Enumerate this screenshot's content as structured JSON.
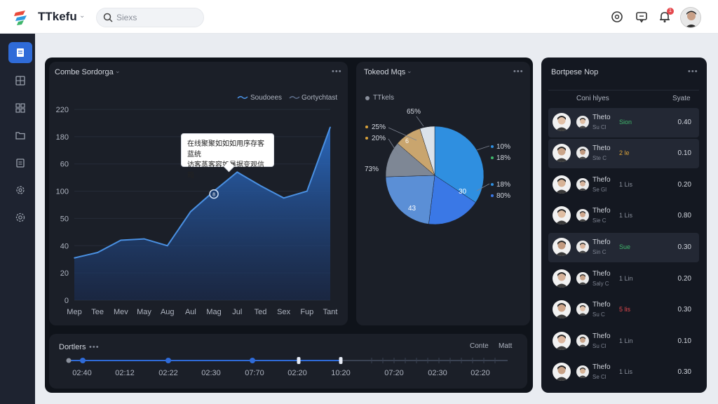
{
  "app": {
    "brand": "TTkefu"
  },
  "search": {
    "placeholder": "Siexs"
  },
  "notifications": {
    "count": "1"
  },
  "line_panel": {
    "title": "Combe Sordorga",
    "more": "•••",
    "legend": [
      "Soudoees",
      "Gortychtast"
    ],
    "tooltip_lines": [
      "在线聚聚如如如用序存客蓝统",
      "访客蒸客容如暴据变观信箱"
    ],
    "chart_data": {
      "type": "area",
      "categories": [
        "Mep",
        "Tee",
        "Mev",
        "May",
        "Aug",
        "Aul",
        "Mag",
        "Jul",
        "Ted",
        "Sex",
        "Fup",
        "Tant"
      ],
      "y_ticks": [
        "220",
        "180",
        "60",
        "100",
        "50",
        "40",
        "20",
        "0"
      ],
      "series": [
        {
          "name": "Soudoees",
          "values": [
            31,
            35,
            44,
            45,
            40,
            65,
            80,
            94,
            84,
            75,
            80,
            127
          ]
        }
      ],
      "annotation_marker": "8"
    }
  },
  "pie_panel": {
    "title": "Tokeod Mqs",
    "more": "•••",
    "legend": "TTkels",
    "chart_data": {
      "type": "pie",
      "slices": [
        {
          "label": "65%",
          "value": 35,
          "color": "#2f8fe0"
        },
        {
          "label": "30",
          "value": 18,
          "color": "#3a78e6"
        },
        {
          "label": "43",
          "value": 23,
          "color": "#5b8fd6"
        },
        {
          "label": "73%",
          "value": 12,
          "color": "#7e8795"
        },
        {
          "label": "25%",
          "value": 9,
          "color": "#c9a56e"
        },
        {
          "label": "20%",
          "value": 5,
          "color": "#dbe2ea"
        }
      ],
      "callouts_left": [
        "25%",
        "20%",
        "73%"
      ],
      "callouts_right": [
        "10%",
        "18%",
        "18%",
        "80%"
      ],
      "inner_labels": [
        "6",
        "30",
        "43"
      ],
      "top_label": "65%"
    }
  },
  "durations": {
    "title": "Dortlers",
    "more": "•••",
    "controls": [
      "Conte",
      "Matt"
    ],
    "times": [
      "02:40",
      "02:12",
      "02:22",
      "02:30",
      "07:70",
      "02:20",
      "10:20",
      "07:20",
      "02:30",
      "02:20"
    ]
  },
  "response": {
    "title": "Bortpese Nop",
    "more": "•••",
    "col_left": "Coni hlyes",
    "col_right": "Syate",
    "rows": [
      {
        "name": "Theto",
        "sub": "Su Cl",
        "val": "Sion",
        "valcolor": "#3fb66b",
        "num": "0.40"
      },
      {
        "name": "Theto",
        "sub": "Ste C",
        "val": "2 le",
        "valcolor": "#d9a23a",
        "num": "0.10"
      },
      {
        "name": "Thefo",
        "sub": "Se Gl",
        "val": "1 Lis",
        "valcolor": "#8a909c",
        "num": "0.20"
      },
      {
        "name": "Thefo",
        "sub": "Sie C",
        "val": "1 Lis",
        "valcolor": "#8a909c",
        "num": "0.80"
      },
      {
        "name": "Thefo",
        "sub": "Sin C",
        "val": "Sue",
        "valcolor": "#3fb66b",
        "num": "0.30"
      },
      {
        "name": "Thefo",
        "sub": "Saly C",
        "val": "1 Lin",
        "valcolor": "#8a909c",
        "num": "0.20"
      },
      {
        "name": "Thefo",
        "sub": "Su C",
        "val": "5 lis",
        "valcolor": "#e5484d",
        "num": "0.30"
      },
      {
        "name": "Thefo",
        "sub": "Su Cl",
        "val": "1 Lin",
        "valcolor": "#8a909c",
        "num": "0.10"
      },
      {
        "name": "Thefo",
        "sub": "Se Cl",
        "val": "1 Lis",
        "valcolor": "#8a909c",
        "num": "0.30"
      }
    ]
  }
}
